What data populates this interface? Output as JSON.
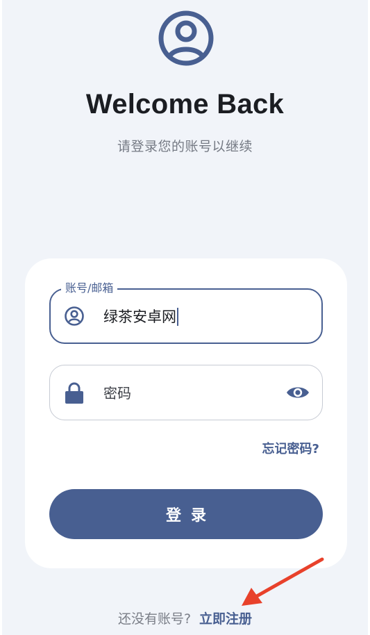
{
  "header": {
    "avatar_icon": "account-circle-icon",
    "title": "Welcome Back",
    "subtitle": "请登录您的账号以继续"
  },
  "form": {
    "account": {
      "label": "账号/邮箱",
      "value": "绿茶安卓网",
      "icon": "user-circle-icon"
    },
    "password": {
      "placeholder": "密码",
      "icon": "lock-icon",
      "toggle_icon": "eye-icon"
    },
    "forgot_label": "忘记密码?",
    "login_label": "登录"
  },
  "footer": {
    "prompt": "还没有账号?",
    "signup_label": "立即注册"
  },
  "colors": {
    "accent": "#485f91",
    "background": "#f1f4f9",
    "card": "#ffffff",
    "annotation_arrow": "#e8412b"
  }
}
